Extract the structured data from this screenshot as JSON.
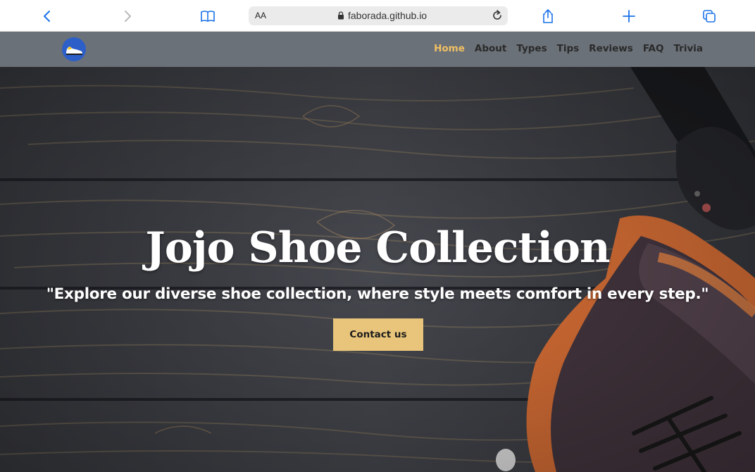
{
  "browser": {
    "text_size_label": "AA",
    "url": "faborada.github.io",
    "icons": [
      "back-icon",
      "forward-icon",
      "bookmarks-icon",
      "lock-icon",
      "reload-icon",
      "share-icon",
      "new-tab-icon",
      "tabs-icon"
    ],
    "accent_color": "#1a73e8"
  },
  "nav": {
    "logo": "shoe-logo",
    "links": [
      "Home",
      "About",
      "Types",
      "Tips",
      "Reviews",
      "FAQ",
      "Trivia"
    ],
    "active": "Home",
    "background": "#6b7178",
    "active_color": "#f0c064"
  },
  "hero": {
    "title": "Jojo Shoe Collection",
    "subtitle": "\"Explore our diverse shoe collection, where style meets comfort in every step.\"",
    "cta_label": "Contact us",
    "cta_color": "#e8c57a"
  }
}
